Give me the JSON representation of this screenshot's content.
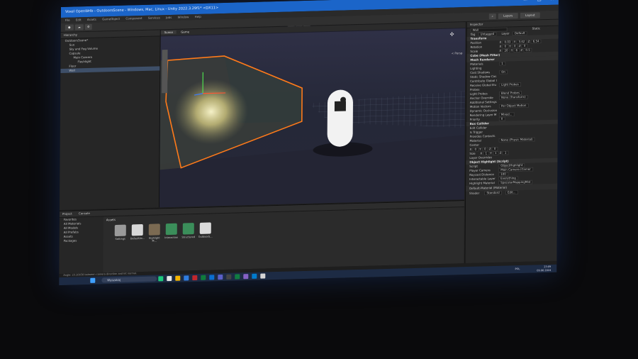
{
  "window": {
    "title": "Voxel OpenWrlb - OutdoorsScene - Windows, Mac, Linux - Unity 2022.3.29f1* <DX11>",
    "controls": {
      "minimize": "—",
      "maximize": "☐",
      "close": "✕"
    }
  },
  "menu": {
    "items": [
      "File",
      "Edit",
      "Assets",
      "GameObject",
      "Component",
      "Services",
      "Jobs",
      "Window",
      "Help"
    ]
  },
  "toolbar": {
    "play": "▶",
    "pause": "❚❚",
    "step": "▶❚",
    "layers": "Layers",
    "layout": "Layout"
  },
  "hierarchy": {
    "tab": "Hierarchy",
    "items": [
      {
        "label": "OutdoorsScene*",
        "depth": 0,
        "selected": false
      },
      {
        "label": "Sun",
        "depth": 1,
        "selected": false
      },
      {
        "label": "Sky and Fog Volume",
        "depth": 1,
        "selected": false
      },
      {
        "label": "Capsule",
        "depth": 1,
        "selected": false
      },
      {
        "label": "Main Camera",
        "depth": 2,
        "selected": false
      },
      {
        "label": "Flashlight",
        "depth": 3,
        "selected": false
      },
      {
        "label": "Floor",
        "depth": 1,
        "selected": false
      },
      {
        "label": "Wall",
        "depth": 1,
        "selected": true
      }
    ]
  },
  "scene": {
    "tabs": [
      "Scene",
      "Game"
    ],
    "view_buttons": [
      "Pivot",
      "Local"
    ],
    "persp_label": "< Persp"
  },
  "inspector": {
    "tab": "Inspector",
    "object_name": "Wall",
    "static_label": "Static",
    "tag_label": "Tag",
    "tag_value": "Untagged",
    "layer_label": "Layer",
    "layer_value": "Default",
    "transform": {
      "header": "Transform",
      "position": {
        "label": "Position",
        "x": "0.03",
        "y": "3.42",
        "z": "6.54"
      },
      "rotation": {
        "label": "Rotation",
        "x": "0",
        "y": "0",
        "z": "0"
      },
      "scale": {
        "label": "Scale",
        "x": "20",
        "y": "6",
        "z": "0.5"
      }
    },
    "components": [
      {
        "header": "Cube (Mesh Filter)"
      },
      {
        "header": "Mesh Renderer"
      }
    ],
    "renderer_rows": [
      {
        "label": "Materials",
        "value": "1"
      },
      {
        "label": "Lighting",
        "value": ""
      },
      {
        "label": "Cast Shadows",
        "value": "On"
      },
      {
        "label": "Static Shadow Cas",
        "value": ""
      },
      {
        "label": "Contribute Global I",
        "value": ""
      },
      {
        "label": "Receive Global Illu",
        "value": "Light Probes"
      },
      {
        "label": "Probes",
        "value": ""
      },
      {
        "label": "Light Probes",
        "value": "Blend Probes"
      },
      {
        "label": "Anchor Override",
        "value": "None (Transform)"
      },
      {
        "label": "Additional Settings",
        "value": ""
      },
      {
        "label": "Motion Vectors",
        "value": "Per Object Motion"
      },
      {
        "label": "Dynamic Occlusion",
        "value": ""
      },
      {
        "label": "Rendering Layer M",
        "value": "Mixed..."
      },
      {
        "label": "Priority",
        "value": "0"
      }
    ],
    "box_collider": {
      "header": "Box Collider",
      "rows": [
        {
          "label": "Edit Collider",
          "value": ""
        },
        {
          "label": "Is Trigger",
          "value": ""
        },
        {
          "label": "Provides Contacts",
          "value": ""
        },
        {
          "label": "Material",
          "value": "None (Physic Material)"
        },
        {
          "label": "Center",
          "value": ""
        }
      ],
      "center": {
        "x": "0",
        "y": "0",
        "z": "0"
      },
      "size_label": "Size",
      "size": {
        "x": "1",
        "y": "1",
        "z": "1"
      },
      "layer_overrides": "Layer Overrides"
    },
    "script": {
      "header": "Object Highlight (Script)",
      "rows": [
        {
          "label": "Script",
          "value": "ObjectHighlight"
        },
        {
          "label": "Player Camera",
          "value": "Main Camera (Camer"
        },
        {
          "label": "Raycast Distance",
          "value": "100"
        },
        {
          "label": "Interactable Layer",
          "value": "Everything"
        },
        {
          "label": "Highlight Material",
          "value": "SpecularMappingMat"
        }
      ]
    },
    "material": {
      "name": "Default-Material (Material)",
      "shader_label": "Shader",
      "shader_value": "Standard",
      "edit": "Edit..."
    }
  },
  "project": {
    "tabs": [
      "Project",
      "Console"
    ],
    "folders": [
      "Favorites",
      "All Materials",
      "All Models",
      "All Prefabs",
      "Assets",
      "Packages"
    ],
    "breadcrumb": "Assets",
    "assets": [
      {
        "label": "Settings",
        "color": "#9a9a9a"
      },
      {
        "label": "DefaultVo...",
        "color": "#d8d8d8"
      },
      {
        "label": "Highlight M...",
        "color": "#7b6a52"
      },
      {
        "label": "Interaction",
        "color": "#3b8e5a"
      },
      {
        "label": "Structured",
        "color": "#3b8e5a"
      },
      {
        "label": "OutdoorS...",
        "color": "#dcdcdc"
      }
    ]
  },
  "status": {
    "text": "Angle: 23.10038 between camera direction and hit normal."
  },
  "taskbar": {
    "search": "Wyszukaj",
    "time": "23:09",
    "date": "09.06.2024",
    "lang": "POL"
  },
  "colors": {
    "titlebar": "#1b65c9",
    "selection": "#3e4f68",
    "wall_outline": "#ff7a1a",
    "light_glow": "#f6efaa"
  }
}
